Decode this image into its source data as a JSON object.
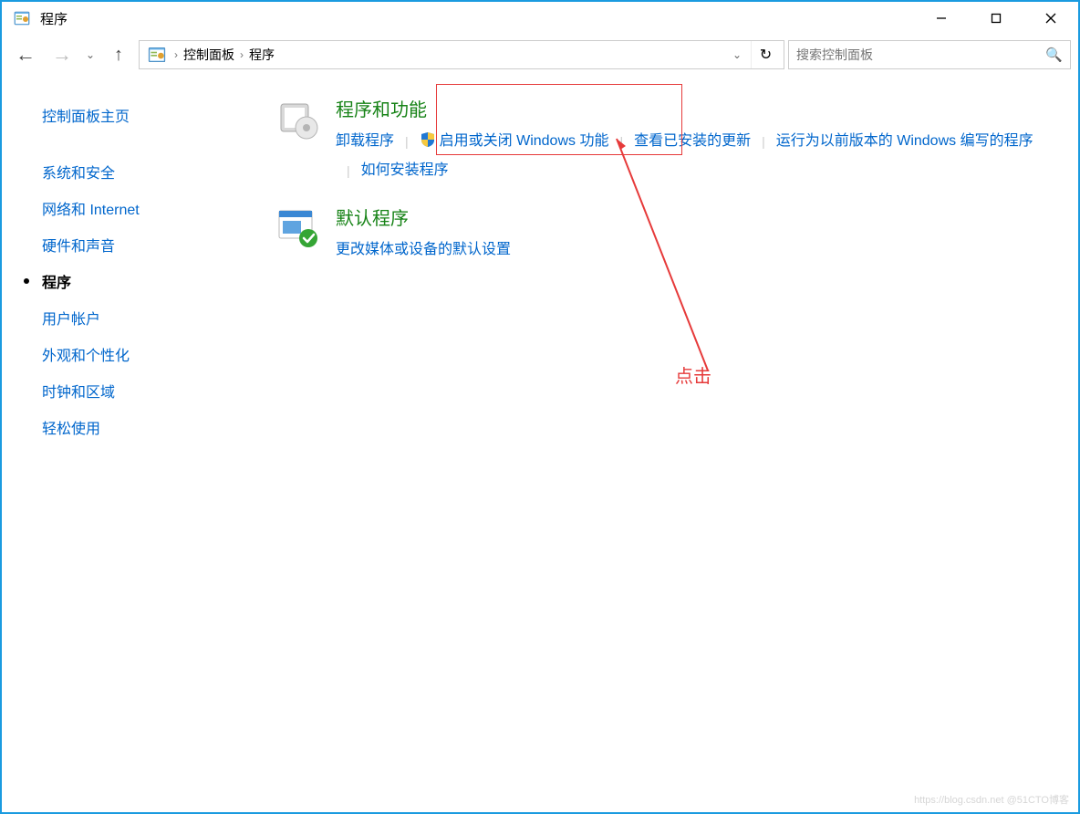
{
  "window": {
    "title": "程序"
  },
  "nav": {
    "breadcrumbs": [
      "控制面板",
      "程序"
    ],
    "search_placeholder": "搜索控制面板"
  },
  "sidebar": {
    "home": "控制面板主页",
    "items": [
      {
        "label": "系统和安全"
      },
      {
        "label": "网络和 Internet"
      },
      {
        "label": "硬件和声音"
      },
      {
        "label": "程序",
        "active": true
      },
      {
        "label": "用户帐户"
      },
      {
        "label": "外观和个性化"
      },
      {
        "label": "时钟和区域"
      },
      {
        "label": "轻松使用"
      }
    ]
  },
  "categories": {
    "programs": {
      "title": "程序和功能",
      "links": {
        "uninstall": "卸载程序",
        "features": "启用或关闭 Windows 功能",
        "updates": "查看已安装的更新",
        "compat": "运行为以前版本的 Windows 编写的程序",
        "howto": "如何安装程序"
      }
    },
    "defaults": {
      "title": "默认程序",
      "links": {
        "media": "更改媒体或设备的默认设置"
      }
    }
  },
  "annotation": {
    "label": "点击"
  },
  "watermark": "https://blog.csdn.net @51CTO博客"
}
